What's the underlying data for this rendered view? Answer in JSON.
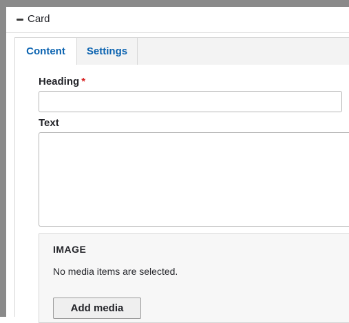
{
  "card": {
    "title": "Card"
  },
  "tabs": [
    {
      "label": "Content",
      "active": true
    },
    {
      "label": "Settings",
      "active": false
    }
  ],
  "fields": {
    "heading": {
      "label": "Heading",
      "required_marker": "*",
      "value": ""
    },
    "text": {
      "label": "Text",
      "value": ""
    }
  },
  "image": {
    "title": "IMAGE",
    "empty_message": "No media items are selected.",
    "add_button": "Add media"
  },
  "colors": {
    "tab_link": "#0b63b0",
    "required": "#d72222",
    "outer_frame": "#8a8a8a"
  }
}
